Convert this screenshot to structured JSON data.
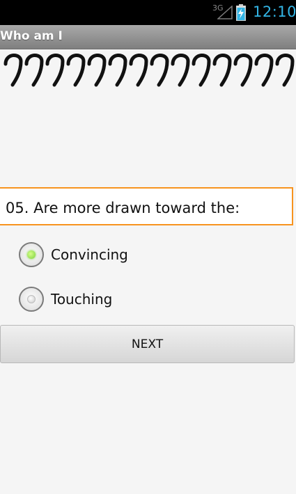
{
  "status_bar": {
    "network": "3G",
    "time": "12:10",
    "icons": [
      "signal-icon",
      "battery-charging-icon"
    ],
    "accent_color": "#33b5e5"
  },
  "app": {
    "title": "Who am I"
  },
  "question": {
    "text": "05. Are more drawn toward the:",
    "border_color": "#f7931e"
  },
  "options": [
    {
      "label": "Convincing",
      "selected": true
    },
    {
      "label": "Touching",
      "selected": false
    }
  ],
  "buttons": {
    "next_label": "NEXT"
  }
}
